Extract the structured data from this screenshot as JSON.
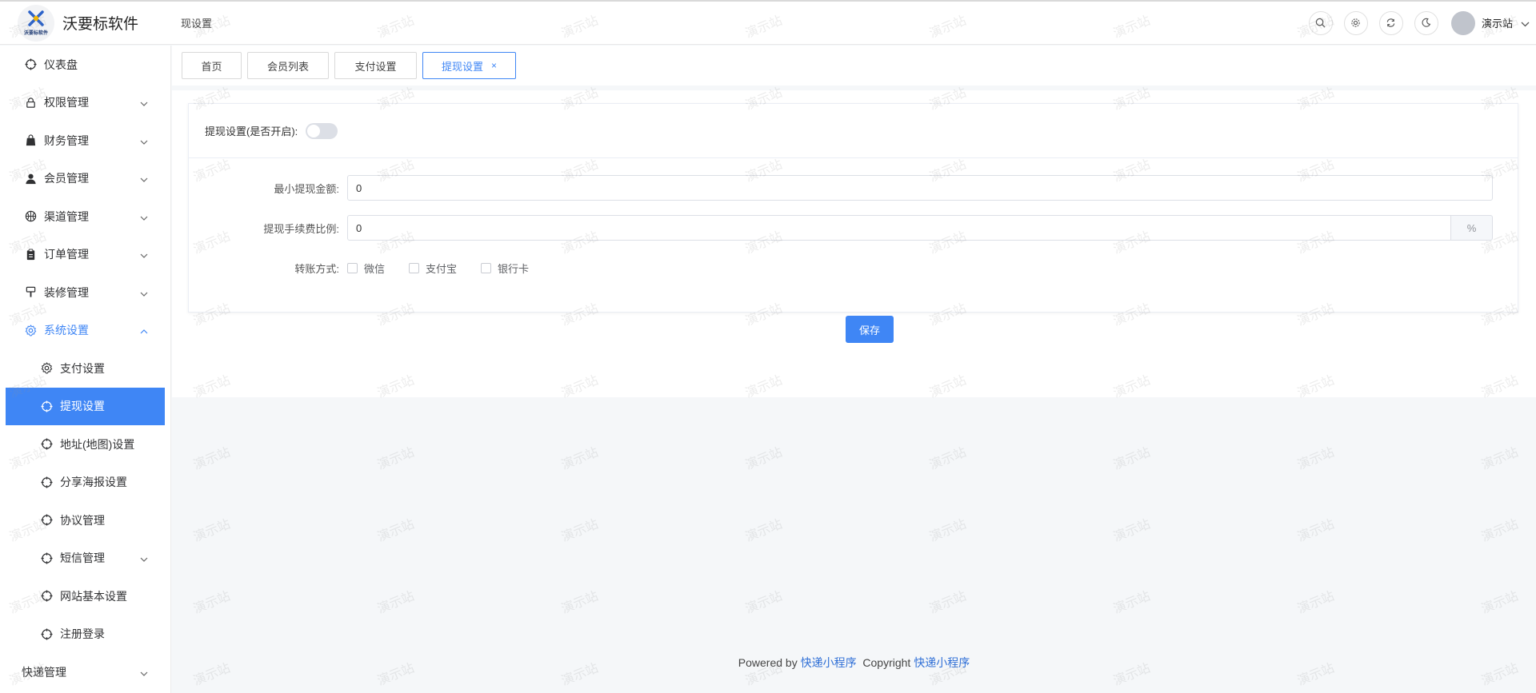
{
  "app": {
    "logo_small_text": "沃要标软件",
    "title": "沃要标软件",
    "breadcrumb": "现设置"
  },
  "header": {
    "user_name": "演示站",
    "tools": [
      "search-icon",
      "gear-icon",
      "refresh-icon",
      "moon-icon"
    ]
  },
  "sidebar": {
    "items": [
      {
        "label": "仪表盘",
        "icon": "crosshair-icon",
        "arrow": ""
      },
      {
        "label": "权限管理",
        "icon": "lock-icon",
        "arrow": "v"
      },
      {
        "label": "财务管理",
        "icon": "bag-icon",
        "arrow": "v"
      },
      {
        "label": "会员管理",
        "icon": "user-icon",
        "arrow": "v"
      },
      {
        "label": "渠道管理",
        "icon": "basketball-icon",
        "arrow": "v"
      },
      {
        "label": "订单管理",
        "icon": "clipboard-icon",
        "arrow": "v"
      },
      {
        "label": "装修管理",
        "icon": "brush-icon",
        "arrow": "v"
      },
      {
        "label": "系统设置",
        "icon": "gear-icon",
        "arrow": "^"
      }
    ],
    "sub_items": [
      {
        "label": "支付设置",
        "icon": "gear-icon"
      },
      {
        "label": "提现设置",
        "icon": "crosshair-icon"
      },
      {
        "label": "地址(地图)设置",
        "icon": "crosshair-icon"
      },
      {
        "label": "分享海报设置",
        "icon": "crosshair-icon"
      },
      {
        "label": "协议管理",
        "icon": "crosshair-icon"
      },
      {
        "label": "短信管理",
        "icon": "crosshair-icon"
      },
      {
        "label": "网站基本设置",
        "icon": "crosshair-icon"
      },
      {
        "label": "注册登录",
        "icon": "crosshair-icon"
      }
    ],
    "bottom_item": "快递管理",
    "collapse": "«"
  },
  "tabs": [
    {
      "label": "首页",
      "active": false
    },
    {
      "label": "会员列表",
      "active": false
    },
    {
      "label": "支付设置",
      "active": false
    },
    {
      "label": "提现设置",
      "active": true,
      "close": "×"
    }
  ],
  "form": {
    "switch_label": "提现设置(是否开启):",
    "switch_on": false,
    "min_amount_label": "最小提现金额:",
    "min_amount_value": "0",
    "fee_label": "提现手续费比例:",
    "fee_value": "0",
    "fee_unit": "%",
    "transfer_label": "转账方式:",
    "transfer_options": [
      {
        "label": "微信",
        "checked": false
      },
      {
        "label": "支付宝",
        "checked": false
      },
      {
        "label": "银行卡",
        "checked": false
      }
    ],
    "save_label": "保存"
  },
  "footer": {
    "powered_by": "Powered by",
    "link1": "快递小程序",
    "copyright": "Copyright",
    "link2": "快递小程序"
  },
  "watermark": "演示站",
  "colors": {
    "accent": "#3f86f5"
  }
}
